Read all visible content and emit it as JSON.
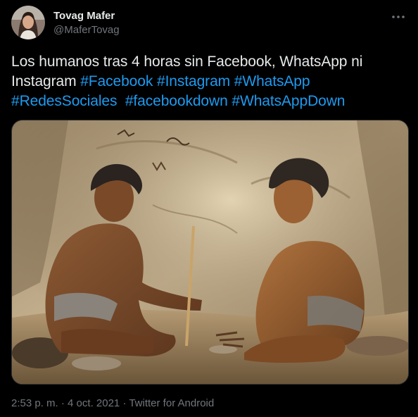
{
  "author": {
    "display_name": "Tovag Mafer",
    "handle": "@MaferTovag"
  },
  "tweet": {
    "text_plain": "Los humanos tras 4 horas sin Facebook, WhatsApp ni Instagram ",
    "hashtags": [
      "#Facebook",
      "#Instagram",
      "#WhatsApp",
      "#RedesSociales",
      "#facebookdown",
      "#WhatsAppDown"
    ]
  },
  "meta": {
    "time": "2:53 p. m.",
    "separator": " · ",
    "date": "4 oct. 2021",
    "source": "Twitter for Android"
  },
  "icons": {
    "more": "more-horizontal-icon"
  },
  "colors": {
    "background": "#000000",
    "text": "#e7e9ea",
    "secondary": "#71767b",
    "accent": "#1d9bf0"
  }
}
